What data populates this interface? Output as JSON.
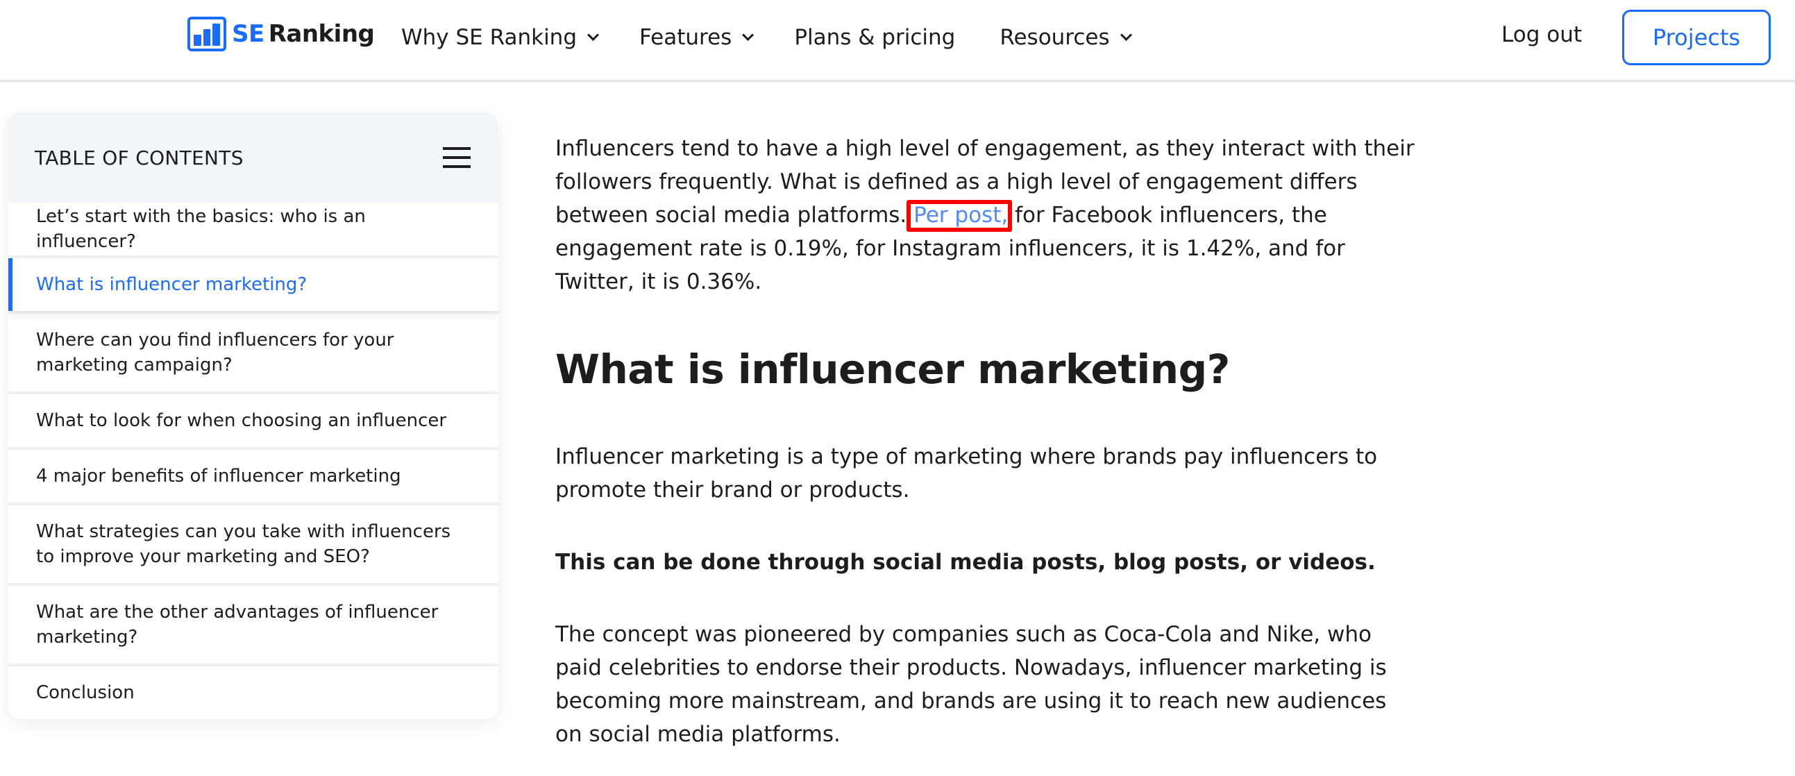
{
  "header": {
    "logo": {
      "prefix": "SE",
      "name": "Ranking",
      "icon": "bar-chart-logo-icon"
    },
    "nav": [
      {
        "label": "Why SE Ranking",
        "has_dropdown": true
      },
      {
        "label": "Features",
        "has_dropdown": true
      },
      {
        "label": "Plans & pricing",
        "has_dropdown": false
      },
      {
        "label": "Resources",
        "has_dropdown": true
      }
    ],
    "logout_label": "Log out",
    "projects_label": "Projects"
  },
  "toc": {
    "title": "TABLE OF CONTENTS",
    "menu_icon": "hamburger-menu-icon",
    "items": [
      {
        "label": "Let’s start with the basics: who is an influencer?",
        "active": false
      },
      {
        "label": "What is influencer marketing?",
        "active": true
      },
      {
        "label": "Where can you find influencers for your marketing campaign?",
        "active": false
      },
      {
        "label": "What to look for when choosing an influencer",
        "active": false
      },
      {
        "label": "4 major benefits of influencer marketing",
        "active": false
      },
      {
        "label": "What strategies can you take with influencers to improve your marketing and SEO?",
        "active": false
      },
      {
        "label": "What are the other advantages of influencer marketing?",
        "active": false
      },
      {
        "label": "Conclusion",
        "active": false
      }
    ]
  },
  "article": {
    "intro": {
      "before_link": "Influencers tend to have a high level of engagement, as they interact with their followers frequently. What is defined as a high level of engagement differs between social media platforms. ",
      "link_text": "Per post,",
      "after_link": " for Facebook influencers, the engagement rate is 0.19%, for Instagram influencers, it is 1.42%, and for Twitter, it is 0.36%."
    },
    "heading": "What is influencer marketing?",
    "paragraph_1": "Influencer marketing is a type of marketing where brands pay influencers to promote their brand or products.",
    "paragraph_bold": "This can be done through social media posts, blog posts, or videos.",
    "paragraph_2": "The concept was pioneered by companies such as Coca-Cola and Nike, who paid celebrities to endorse their products. Nowadays, influencer marketing is becoming more mainstream, and brands are using it to reach new audiences on social media platforms."
  },
  "colors": {
    "brand_blue": "#1a6cff",
    "link_blue": "#4f8bff",
    "annotation_red": "#ff0000",
    "text": "#1d1d1f"
  }
}
